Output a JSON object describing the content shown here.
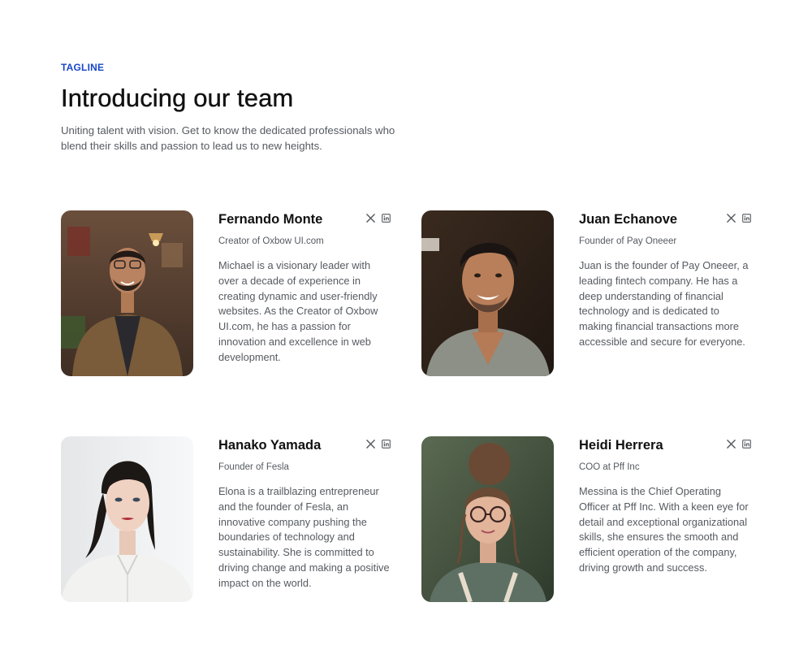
{
  "header": {
    "tagline": "TAGLINE",
    "title": "Introducing our team",
    "intro": "Uniting talent with vision. Get to know the dedicated professionals who blend their skills and passion to lead us to new heights."
  },
  "colors": {
    "accent": "#1747c9",
    "heading": "#111111",
    "body_text": "#555a60",
    "icon": "#555a60"
  },
  "members": [
    {
      "name": "Fernando Monte",
      "role": "Creator of Oxbow UI.com",
      "bio": "Michael is a visionary leader with over a decade of experience in creating dynamic and user-friendly websites. As the Creator of Oxbow UI.com, he has a passion for innovation and excellence in web development.",
      "socials": [
        "x-icon",
        "linkedin-icon"
      ]
    },
    {
      "name": "Juan Echanove",
      "role": "Founder of Pay Oneeer",
      "bio": "Juan is the founder of Pay Oneeer, a leading fintech company. He has a deep understanding of financial technology and is dedicated to making financial transactions more accessible and secure for everyone.",
      "socials": [
        "x-icon",
        "linkedin-icon"
      ]
    },
    {
      "name": "Hanako Yamada",
      "role": "Founder of Fesla",
      "bio": "Elona is a trailblazing entrepreneur and the founder of Fesla, an innovative company pushing the boundaries of technology and sustainability. She is committed to driving change and making a positive impact on the world.",
      "socials": [
        "x-icon",
        "linkedin-icon"
      ]
    },
    {
      "name": "Heidi Herrera",
      "role": "COO at Pff Inc",
      "bio": "Messina is the Chief Operating Officer at Pff Inc. With a keen eye for detail and exceptional organizational skills, she ensures the smooth and efficient operation of the company, driving growth and success.",
      "socials": [
        "x-icon",
        "linkedin-icon"
      ]
    }
  ]
}
